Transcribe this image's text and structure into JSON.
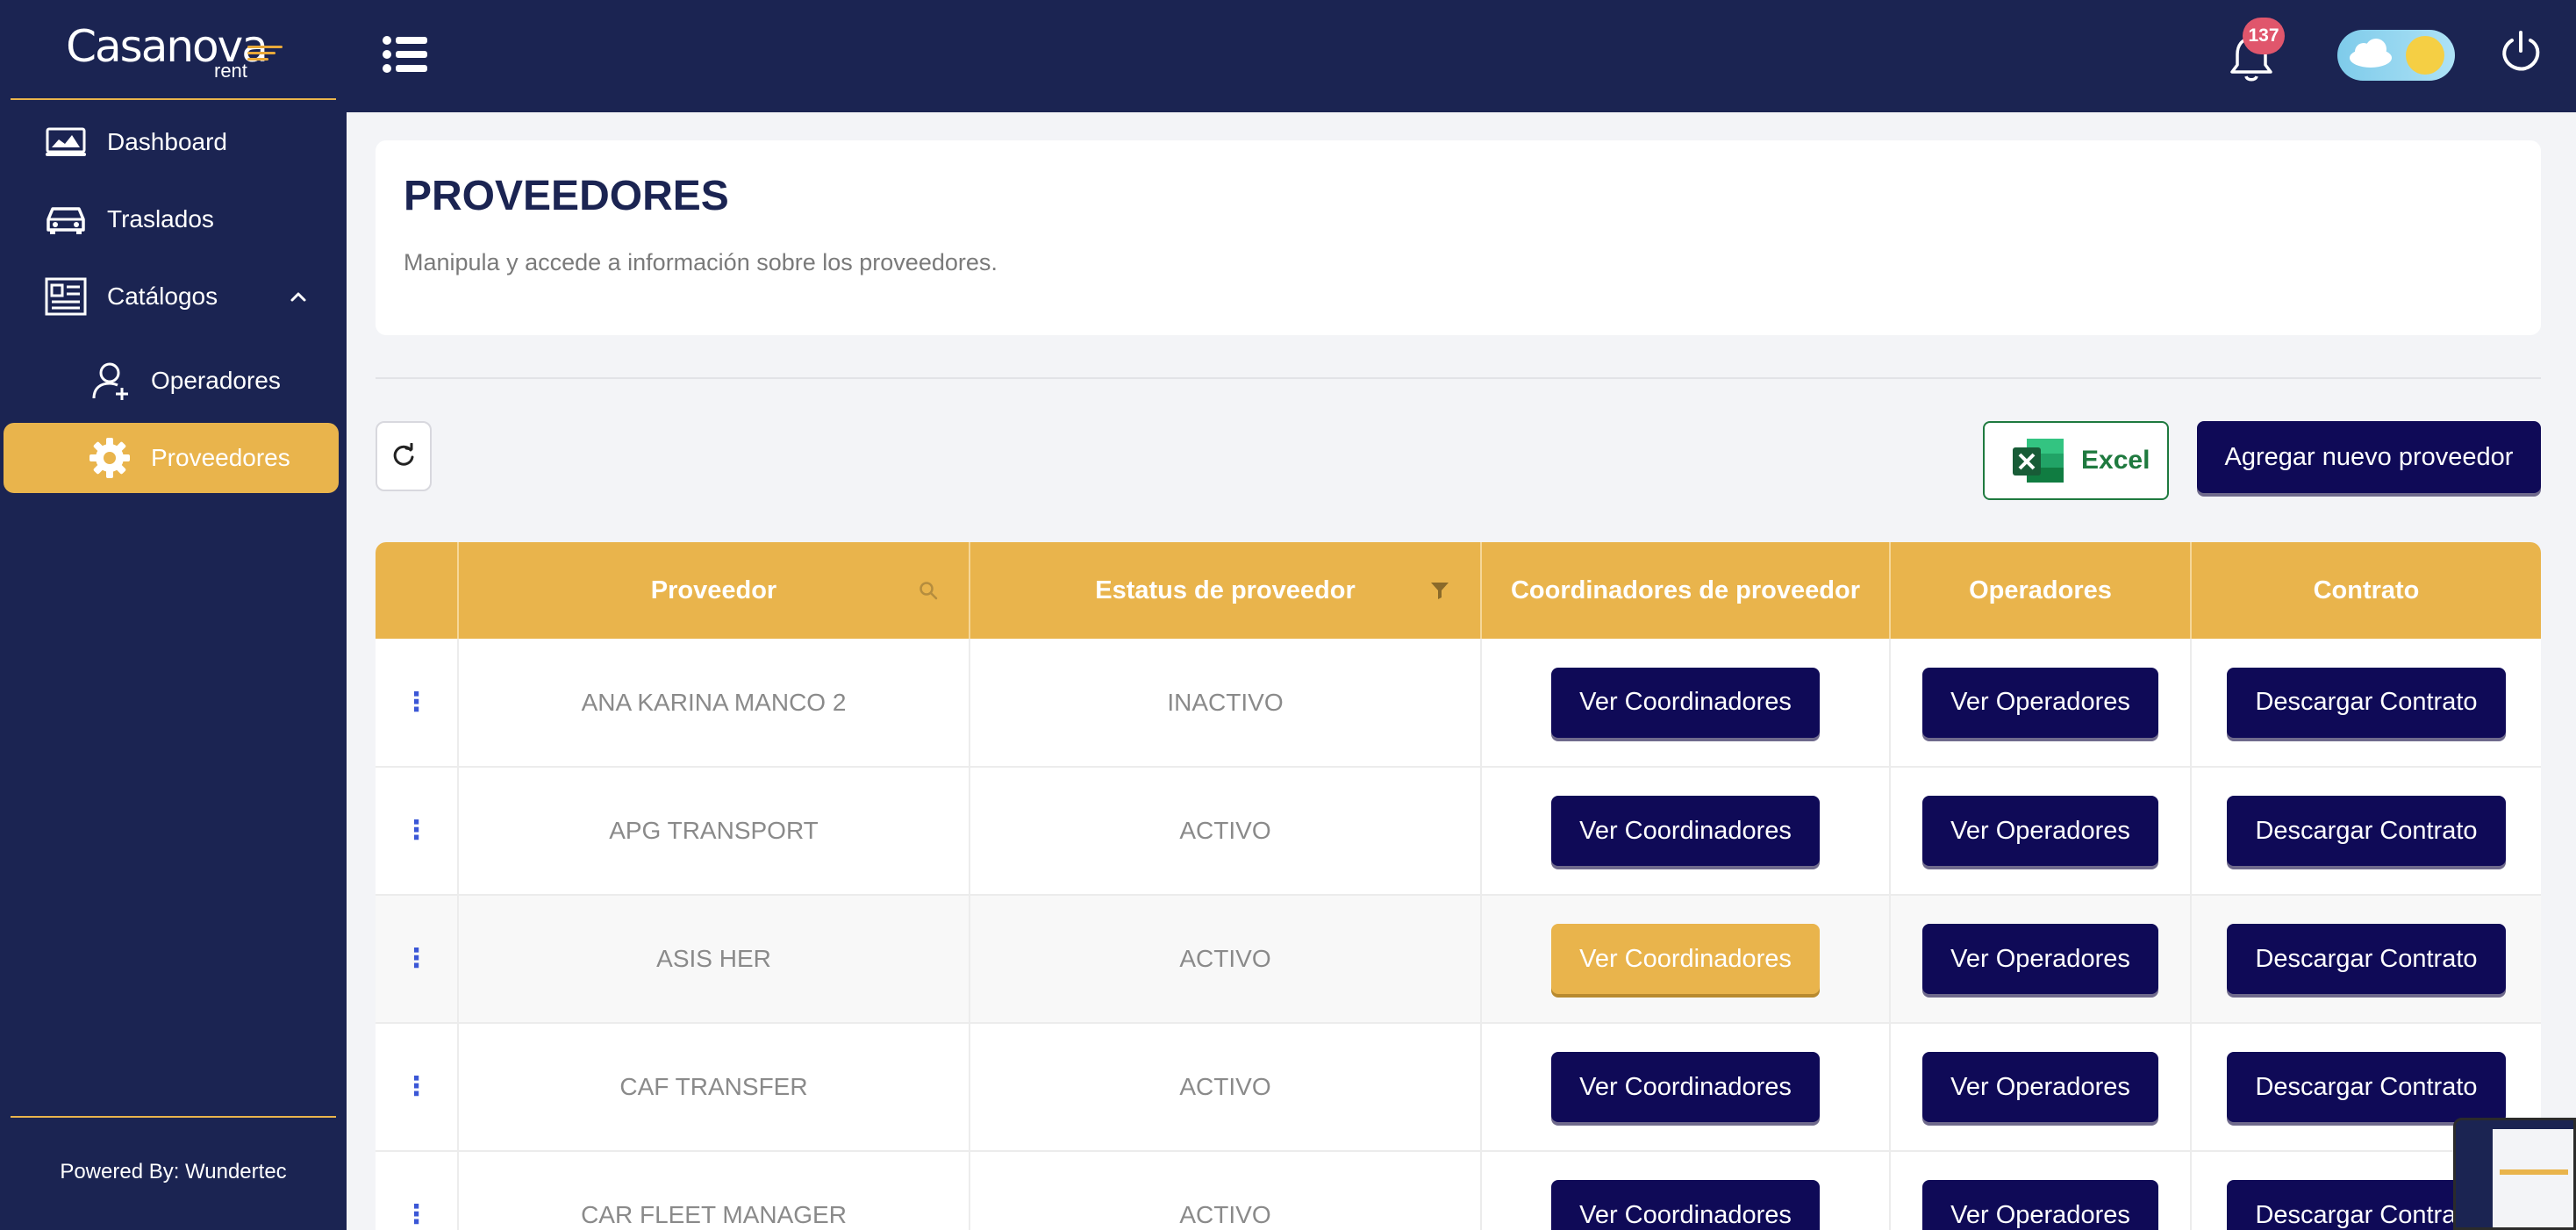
{
  "brand": {
    "name": "Casanova",
    "sub": "rent",
    "accent": "#e9b44c",
    "navy": "#1b2452",
    "button": "#0f0a57"
  },
  "sidebar": {
    "items": [
      {
        "label": "Dashboard",
        "icon": "dashboard-icon"
      },
      {
        "label": "Traslados",
        "icon": "car-icon"
      },
      {
        "label": "Catálogos",
        "icon": "catalog-icon",
        "expanded": true
      },
      {
        "label": "Operadores",
        "icon": "user-add-icon"
      },
      {
        "label": "Proveedores",
        "icon": "gear-icon",
        "active": true
      }
    ],
    "footer": "Powered By: Wundertec"
  },
  "topbar": {
    "notifications": "137"
  },
  "page": {
    "title": "PROVEEDORES",
    "subtitle": "Manipula y accede a información sobre los proveedores."
  },
  "toolbar": {
    "excel_label": "Excel",
    "add_label": "Agregar nuevo proveedor"
  },
  "table": {
    "columns": [
      "",
      "Proveedor",
      "Estatus de proveedor",
      "Coordinadores de proveedor",
      "Operadores",
      "Contrato"
    ],
    "action_labels": {
      "coordinators": "Ver Coordinadores",
      "operators": "Ver Operadores",
      "contract": "Descargar Contrato"
    },
    "rows": [
      {
        "name": "ANA KARINA MANCO 2",
        "status": "INACTIVO"
      },
      {
        "name": "APG TRANSPORT",
        "status": "ACTIVO"
      },
      {
        "name": "ASIS HER",
        "status": "ACTIVO"
      },
      {
        "name": "CAF TRANSFER",
        "status": "ACTIVO"
      },
      {
        "name": "CAR FLEET MANAGER",
        "status": "ACTIVO"
      }
    ]
  }
}
